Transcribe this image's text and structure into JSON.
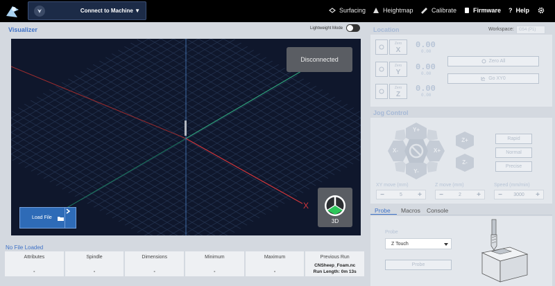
{
  "topbar": {
    "connect_label": "Connect to Machine ▼",
    "nav": [
      {
        "label": "Surfacing",
        "icon": "surfacing-icon"
      },
      {
        "label": "Heightmap",
        "icon": "heightmap-icon"
      },
      {
        "label": "Calibrate",
        "icon": "calibrate-icon"
      },
      {
        "label": "Firmware",
        "icon": "firmware-icon"
      },
      {
        "label": "Help",
        "icon": "help-icon"
      }
    ],
    "settings_icon": "gear-icon"
  },
  "visualizer": {
    "title": "Visualizer",
    "lightweight_label": "Lightweight Mode",
    "lightweight_on": false,
    "status": "Disconnected",
    "axis_label": "X",
    "view_label": "3D",
    "load_file_label": "Load File"
  },
  "file_info": {
    "status": "No File Loaded",
    "columns": [
      {
        "header": "Attributes",
        "value": "-"
      },
      {
        "header": "Spindle",
        "value": "-"
      },
      {
        "header": "Dimensions",
        "value": "-"
      },
      {
        "header": "Minimum",
        "value": "-"
      },
      {
        "header": "Maximum",
        "value": "-"
      }
    ],
    "previous_run": {
      "header": "Previous Run",
      "file": "CNSheep_Foam.nc",
      "run_length": "Run Length: 0m 13s"
    }
  },
  "location": {
    "title": "Location",
    "workspace_label": "Workspace:",
    "workspace_value": "G54 (P1)",
    "axes": [
      {
        "axis": "X",
        "zero_label": "Zero",
        "value": "0.00",
        "machine": "0.00"
      },
      {
        "axis": "Y",
        "zero_label": "Zero",
        "value": "0.00",
        "machine": "0.00"
      },
      {
        "axis": "Z",
        "zero_label": "Zero",
        "value": "0.00",
        "machine": "0.00"
      }
    ],
    "zero_all_label": "Zero All",
    "goto_label": "Go XY0"
  },
  "jog": {
    "title": "Jog Control",
    "xy_buttons": {
      "y_plus": "Y+",
      "y_minus": "Y-",
      "x_plus": "X+",
      "x_minus": "X-"
    },
    "z_buttons": {
      "z_plus": "Z+",
      "z_minus": "Z-"
    },
    "modes": [
      "Rapid",
      "Normal",
      "Precise"
    ],
    "xy_move": {
      "label": "XY move (mm)",
      "value": "5"
    },
    "z_move": {
      "label": "Z move (mm)",
      "value": "2"
    },
    "speed": {
      "label": "Speed (mm/min)",
      "value": "3000"
    }
  },
  "tabs": [
    "Probe",
    "Macros",
    "Console"
  ],
  "probe": {
    "label": "Probe",
    "select_value": "Z Touch",
    "button_label": "Probe"
  }
}
